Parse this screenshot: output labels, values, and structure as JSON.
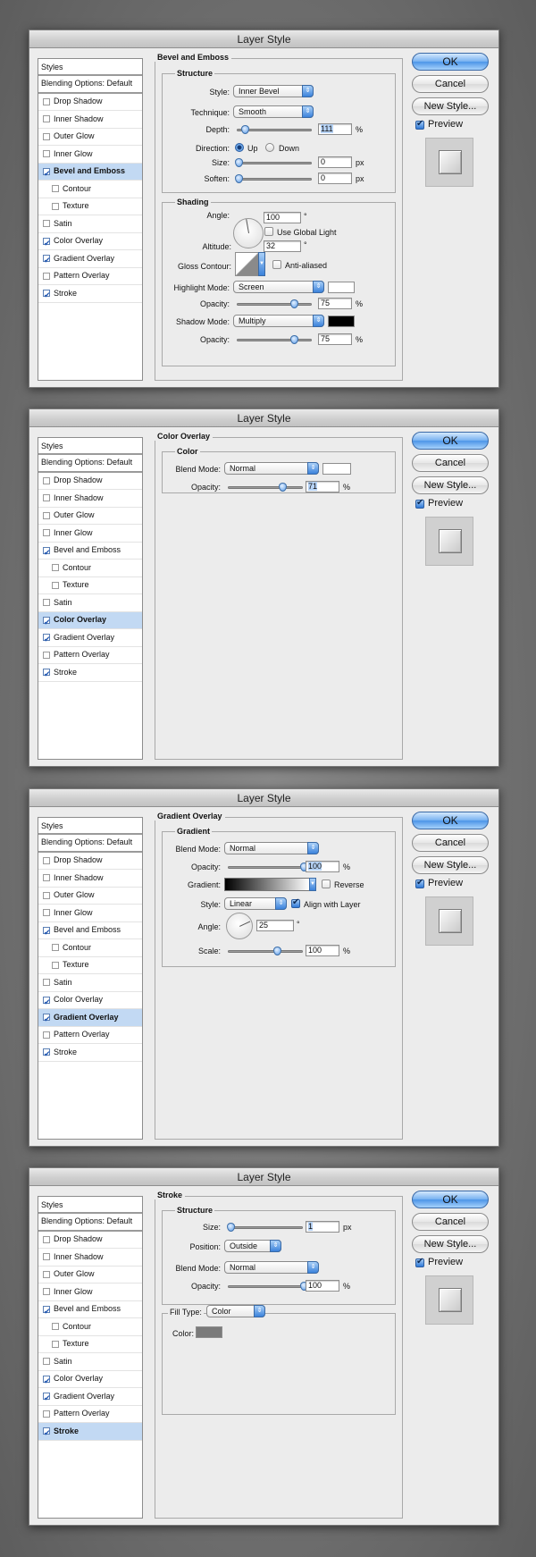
{
  "dialogs": [
    {
      "title": "Layer Style",
      "sidebar": {
        "header": "Styles",
        "blending": "Blending Options: Default",
        "items": [
          {
            "label": "Drop Shadow",
            "checked": false
          },
          {
            "label": "Inner Shadow",
            "checked": false
          },
          {
            "label": "Outer Glow",
            "checked": false
          },
          {
            "label": "Inner Glow",
            "checked": false
          },
          {
            "label": "Bevel and Emboss",
            "checked": true
          },
          {
            "label": "Contour",
            "checked": false
          },
          {
            "label": "Texture",
            "checked": false
          },
          {
            "label": "Satin",
            "checked": false
          },
          {
            "label": "Color Overlay",
            "checked": true
          },
          {
            "label": "Gradient Overlay",
            "checked": true
          },
          {
            "label": "Pattern Overlay",
            "checked": false
          },
          {
            "label": "Stroke",
            "checked": true
          }
        ]
      },
      "panel_title": "Bevel and Emboss",
      "structure": {
        "title": "Structure",
        "style_label": "Style:",
        "style_value": "Inner Bevel",
        "technique_label": "Technique:",
        "technique_value": "Smooth",
        "depth_label": "Depth:",
        "depth_value": "111",
        "depth_unit": "%",
        "direction_label": "Direction:",
        "up_label": "Up",
        "down_label": "Down",
        "size_label": "Size:",
        "size_value": "0",
        "size_unit": "px",
        "soften_label": "Soften:",
        "soften_value": "0",
        "soften_unit": "px"
      },
      "shading": {
        "title": "Shading",
        "angle_label": "Angle:",
        "angle_value": "100",
        "angle_unit": "°",
        "global_light_label": "Use Global Light",
        "altitude_label": "Altitude:",
        "altitude_value": "32",
        "altitude_unit": "°",
        "gloss_label": "Gloss Contour:",
        "anti_aliased_label": "Anti-aliased",
        "highlight_label": "Highlight Mode:",
        "highlight_value": "Screen",
        "highlight_color": "#ffffff",
        "opacity1_label": "Opacity:",
        "opacity1_value": "75",
        "opacity1_unit": "%",
        "shadow_label": "Shadow Mode:",
        "shadow_value": "Multiply",
        "shadow_color": "#000000",
        "opacity2_label": "Opacity:",
        "opacity2_value": "75",
        "opacity2_unit": "%"
      }
    },
    {
      "title": "Layer Style",
      "panel_title": "Color Overlay",
      "color": {
        "title": "Color",
        "blend_label": "Blend Mode:",
        "blend_value": "Normal",
        "blend_color": "#ffffff",
        "opacity_label": "Opacity:",
        "opacity_value": "71",
        "opacity_unit": "%"
      }
    },
    {
      "title": "Layer Style",
      "panel_title": "Gradient Overlay",
      "gradient": {
        "title": "Gradient",
        "blend_label": "Blend Mode:",
        "blend_value": "Normal",
        "opacity_label": "Opacity:",
        "opacity_value": "100",
        "opacity_unit": "%",
        "gradient_label": "Gradient:",
        "reverse_label": "Reverse",
        "style_label": "Style:",
        "style_value": "Linear",
        "align_label": "Align with Layer",
        "angle_label": "Angle:",
        "angle_value": "25",
        "angle_unit": "°",
        "scale_label": "Scale:",
        "scale_value": "100",
        "scale_unit": "%"
      }
    },
    {
      "title": "Layer Style",
      "panel_title": "Stroke",
      "stroke": {
        "title": "Structure",
        "size_label": "Size:",
        "size_value": "1",
        "size_unit": "px",
        "position_label": "Position:",
        "position_value": "Outside",
        "blend_label": "Blend Mode:",
        "blend_value": "Normal",
        "opacity_label": "Opacity:",
        "opacity_value": "100",
        "opacity_unit": "%",
        "fill_type_label": "Fill Type:",
        "fill_type_value": "Color",
        "color_label": "Color:",
        "color_value": "#7a7a7a"
      }
    }
  ],
  "buttons": {
    "ok": "OK",
    "cancel": "Cancel",
    "new_style": "New Style...",
    "preview": "Preview"
  },
  "selected_items": [
    "Bevel and Emboss",
    "Color Overlay",
    "Gradient Overlay",
    "Stroke"
  ]
}
